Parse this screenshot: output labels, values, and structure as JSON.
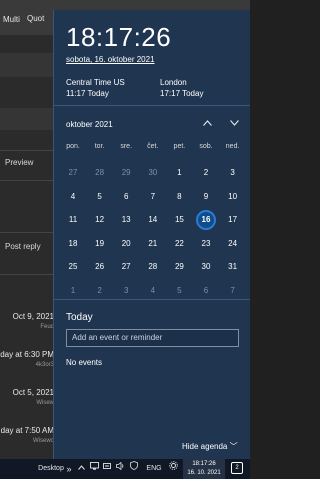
{
  "background": {
    "toolbar": {
      "multi": "Multi",
      "quote": "Quot"
    },
    "preview": "Preview",
    "post_reply": "Post reply",
    "posts": [
      {
        "date": "Oct 9, 2021",
        "sub": "Feud"
      },
      {
        "date": "day at 6:30 PM",
        "sub": "4k3or3"
      },
      {
        "date": "Oct 5, 2021",
        "sub": "Wisew"
      },
      {
        "date": "day at 7:50 AM",
        "sub": "Wisewo"
      }
    ]
  },
  "flyout": {
    "clock": "18:17:26",
    "date_long": "sobota, 16. oktober 2021",
    "timezones": [
      {
        "name": "Central Time US",
        "time": "11:17 Today"
      },
      {
        "name": "London",
        "time": "17:17 Today"
      }
    ],
    "month_label": "oktober 2021",
    "weekdays": [
      "pon.",
      "tor.",
      "sre.",
      "čet.",
      "pet.",
      "sob.",
      "ned."
    ],
    "weeks": [
      [
        {
          "d": "27",
          "dim": true
        },
        {
          "d": "28",
          "dim": true
        },
        {
          "d": "29",
          "dim": true
        },
        {
          "d": "30",
          "dim": true
        },
        {
          "d": "1"
        },
        {
          "d": "2"
        },
        {
          "d": "3"
        }
      ],
      [
        {
          "d": "4"
        },
        {
          "d": "5"
        },
        {
          "d": "6"
        },
        {
          "d": "7"
        },
        {
          "d": "8"
        },
        {
          "d": "9"
        },
        {
          "d": "10"
        }
      ],
      [
        {
          "d": "11"
        },
        {
          "d": "12"
        },
        {
          "d": "13"
        },
        {
          "d": "14"
        },
        {
          "d": "15"
        },
        {
          "d": "16",
          "today": true
        },
        {
          "d": "17"
        }
      ],
      [
        {
          "d": "18"
        },
        {
          "d": "19"
        },
        {
          "d": "20"
        },
        {
          "d": "21"
        },
        {
          "d": "22"
        },
        {
          "d": "23"
        },
        {
          "d": "24"
        }
      ],
      [
        {
          "d": "25"
        },
        {
          "d": "26"
        },
        {
          "d": "27"
        },
        {
          "d": "28"
        },
        {
          "d": "29"
        },
        {
          "d": "30"
        },
        {
          "d": "31"
        }
      ],
      [
        {
          "d": "1",
          "dim": true
        },
        {
          "d": "2",
          "dim": true
        },
        {
          "d": "3",
          "dim": true
        },
        {
          "d": "4",
          "dim": true
        },
        {
          "d": "5",
          "dim": true
        },
        {
          "d": "6",
          "dim": true
        },
        {
          "d": "7",
          "dim": true
        }
      ]
    ],
    "agenda_title": "Today",
    "event_placeholder": "Add an event or reminder",
    "no_events": "No events",
    "hide_agenda": "Hide agenda ﹀"
  },
  "taskbar": {
    "desktop": "Desktop",
    "chevron": "»",
    "lang": "ENG",
    "time": "18:17:26",
    "date": "16. 10. 2021",
    "notifications": "2"
  }
}
